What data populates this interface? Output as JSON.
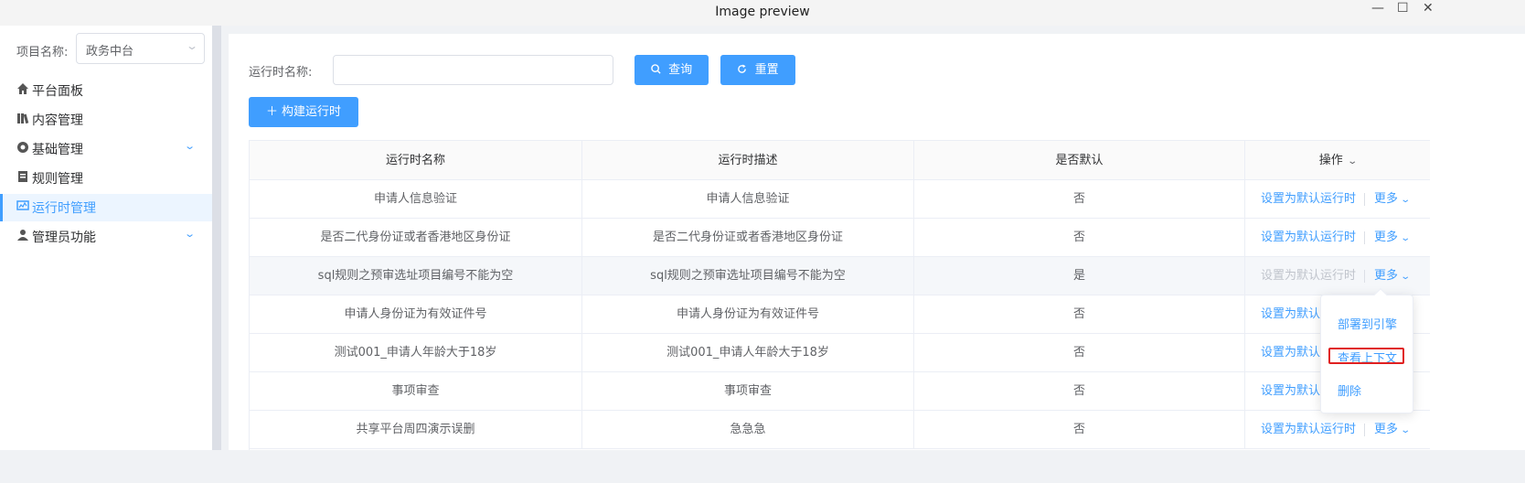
{
  "window": {
    "title": "Image preview",
    "minimize": "—",
    "maximize": "☐",
    "close": "✕"
  },
  "sidebar": {
    "project_label": "项目名称:",
    "project_value": "政务中台",
    "items": [
      {
        "label": "平台面板",
        "icon": "home-icon"
      },
      {
        "label": "内容管理",
        "icon": "books-icon"
      },
      {
        "label": "基础管理",
        "icon": "gear-icon",
        "expandable": true
      },
      {
        "label": "规则管理",
        "icon": "document-icon"
      },
      {
        "label": "运行时管理",
        "icon": "monitor-icon",
        "active": true
      },
      {
        "label": "管理员功能",
        "icon": "user-icon",
        "expandable": true
      }
    ]
  },
  "filter": {
    "label": "运行时名称:",
    "value": "",
    "search_button": "查询",
    "reset_button": "重置",
    "build_button": "构建运行时"
  },
  "table": {
    "columns": [
      "运行时名称",
      "运行时描述",
      "是否默认",
      "操作"
    ],
    "rows": [
      {
        "name": "申请人信息验证",
        "desc": "申请人信息验证",
        "default": "否",
        "action": "设置为默认运行时",
        "more": "更多"
      },
      {
        "name": "是否二代身份证或者香港地区身份证",
        "desc": "是否二代身份证或者香港地区身份证",
        "default": "否",
        "action": "设置为默认运行时",
        "more": "更多"
      },
      {
        "name": "sql规则之预审选址项目编号不能为空",
        "desc": "sql规则之预审选址项目编号不能为空",
        "default": "是",
        "action": "设置为默认运行时",
        "more": "更多"
      },
      {
        "name": "申请人身份证为有效证件号",
        "desc": "申请人身份证为有效证件号",
        "default": "否",
        "action": "设置为默认",
        "more": ""
      },
      {
        "name": "测试001_申请人年龄大于18岁",
        "desc": "测试001_申请人年龄大于18岁",
        "default": "否",
        "action": "设置为默认",
        "more": ""
      },
      {
        "name": "事项审查",
        "desc": "事项审查",
        "default": "否",
        "action": "设置为默认",
        "more": ""
      },
      {
        "name": "共享平台周四演示误删",
        "desc": "急急急",
        "default": "否",
        "action": "设置为默认运行时",
        "more": "更多"
      }
    ]
  },
  "dropdown": {
    "items": [
      "部署到引擎",
      "查看上下文",
      "删除"
    ]
  },
  "colors": {
    "primary": "#409eff",
    "highlight_box": "#e02020"
  }
}
